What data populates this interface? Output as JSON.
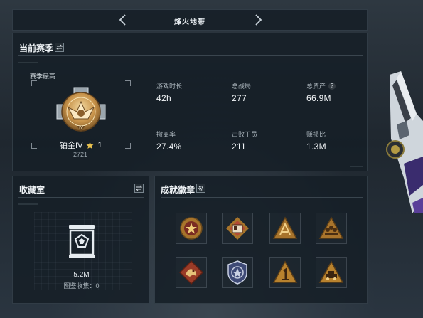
{
  "nav": {
    "title": "烽火地带",
    "prev_icon": "chevron-left-icon",
    "next_icon": "chevron-right-icon"
  },
  "season": {
    "title": "当前赛季",
    "swap_icon": "swap-icon",
    "peak_label": "赛季最高",
    "rank": {
      "name": "铂金IV",
      "star_icon": "star-icon",
      "stars": "1",
      "score": "2721"
    },
    "stats": [
      {
        "label": "游戏时长",
        "value": "42h"
      },
      {
        "label": "总战局",
        "value": "277"
      },
      {
        "label": "总资产",
        "value": "66.9M",
        "help": "?"
      },
      {
        "label": "撤离率",
        "value": "27.4%"
      },
      {
        "label": "击败干员",
        "value": "211"
      },
      {
        "label": "赚损比",
        "value": "1.3M"
      }
    ]
  },
  "collection": {
    "title": "收藏室",
    "swap_icon": "swap-icon",
    "value": "5.2M",
    "count_label": "图鉴收集：",
    "count": "0"
  },
  "achievements": {
    "title": "成就徽章",
    "settings_icon": "gear-icon",
    "badges": [
      {
        "name": "badge-star-emblem",
        "color": "#b8862f"
      },
      {
        "name": "badge-id-card",
        "color": "#c05a3a"
      },
      {
        "name": "badge-triangle-rifle",
        "color": "#b87a2c"
      },
      {
        "name": "badge-triangle-squad",
        "color": "#b87a2c"
      },
      {
        "name": "badge-dragon-diamond",
        "color": "#b8472c"
      },
      {
        "name": "badge-shield-police",
        "color": "#3f4b78"
      },
      {
        "name": "badge-triangle-one",
        "color": "#c38a2a"
      },
      {
        "name": "badge-triangle-vehicle",
        "color": "#c38a2a"
      }
    ]
  },
  "colors": {
    "accent_gold": "#d9a441",
    "panel": "#161f27",
    "text": "#dfe6ec"
  }
}
